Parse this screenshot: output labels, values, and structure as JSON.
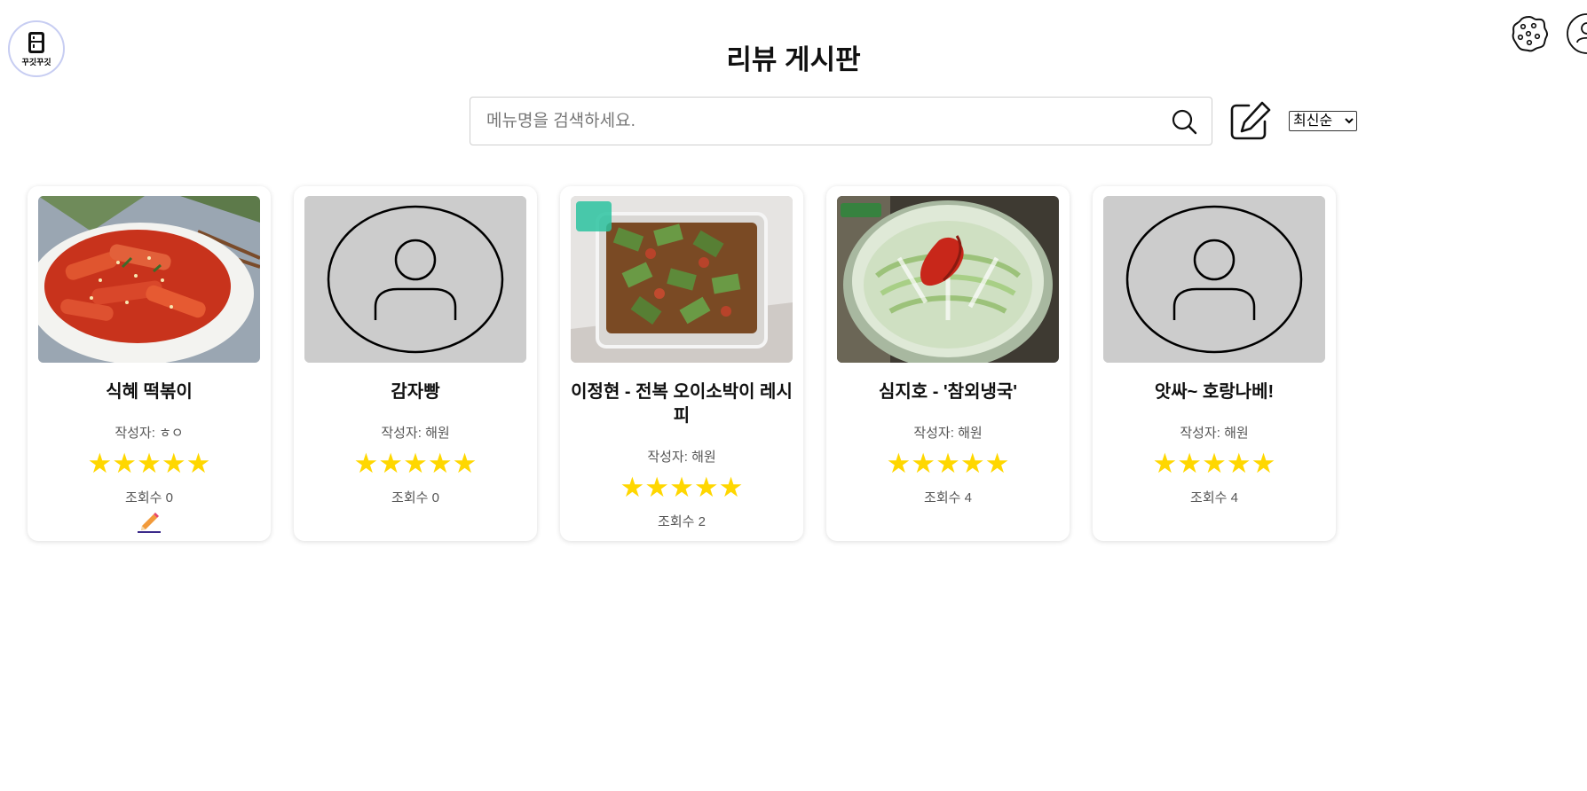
{
  "header": {
    "logo_text": "꾸깃꾸깃",
    "title": "리뷰 게시판"
  },
  "search": {
    "placeholder": "메뉴명을 검색하세요.",
    "value": ""
  },
  "sort": {
    "selected": "최신순"
  },
  "colors": {
    "star": "#FFD700",
    "placeholder_bg": "#cccccc",
    "logo_border": "#c7cdf2"
  },
  "icons": [
    "cookie-icon",
    "profile-icon",
    "search-icon",
    "write-icon",
    "pencil-edit-icon",
    "user-placeholder-icon"
  ],
  "cards": [
    {
      "title": "식혜 떡볶이",
      "author": "작성자: ㅎㅇ",
      "stars": "★★★★★",
      "rating": 5,
      "views": "조회수 0",
      "image": "tteokbokki-photo",
      "editable": true
    },
    {
      "title": "감자빵",
      "author": "작성자: 해원",
      "stars": "★★★★★",
      "rating": 5,
      "views": "조회수 0",
      "image": "user-placeholder-icon",
      "editable": false
    },
    {
      "title": "이정현 - 전복 오이소박이 레시피",
      "author": "작성자: 해원",
      "stars": "★★★★★",
      "rating": 5,
      "views": "조회수 2",
      "image": "oisobagi-photo",
      "editable": false
    },
    {
      "title": "심지호 - '참외냉국'",
      "author": "작성자: 해원",
      "stars": "★★★★★",
      "rating": 5,
      "views": "조회수 4",
      "image": "cold-soup-photo",
      "editable": false
    },
    {
      "title": "앗싸~ 호랑나베!",
      "author": "작성자: 해원",
      "stars": "★★★★★",
      "rating": 5,
      "views": "조회수 4",
      "image": "user-placeholder-icon",
      "editable": false
    }
  ]
}
